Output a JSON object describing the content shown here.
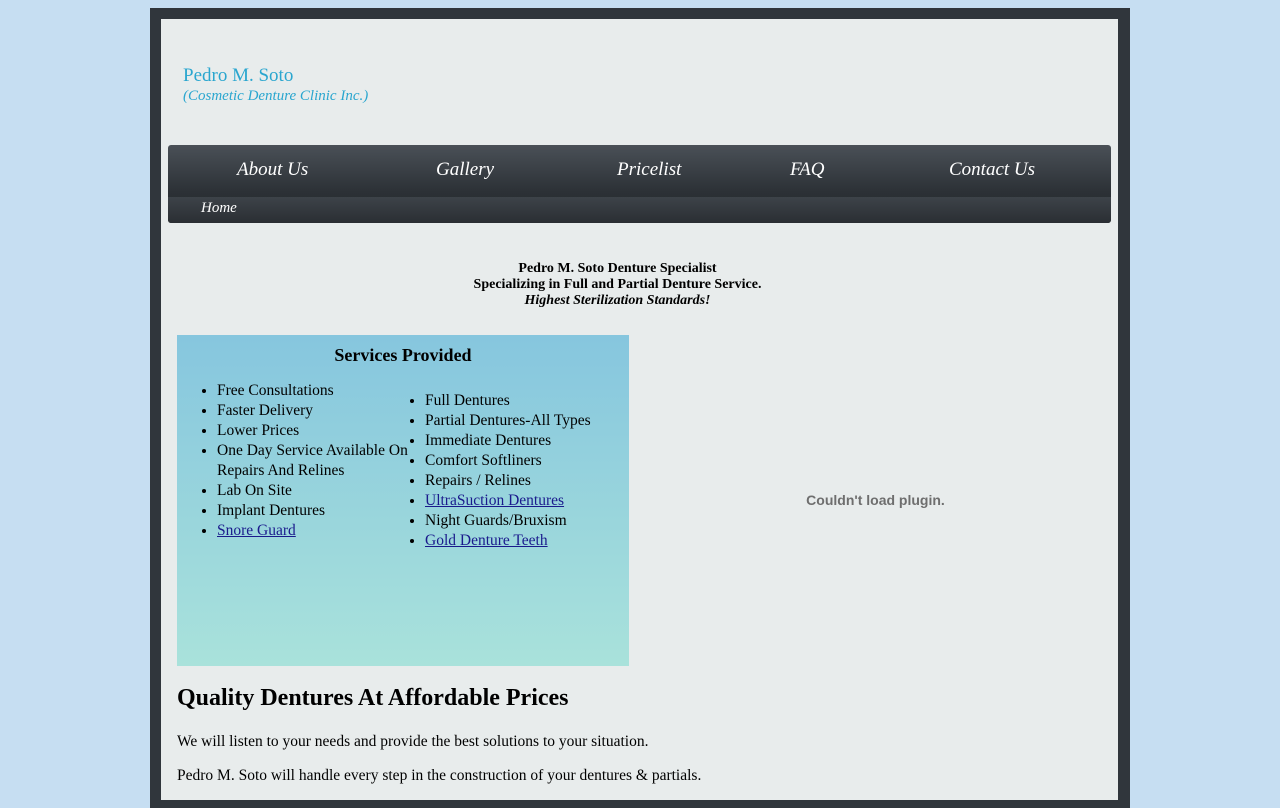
{
  "header": {
    "name": "Pedro M. Soto",
    "tagline": "(Cosmetic Denture Clinic Inc.)"
  },
  "nav": {
    "items": [
      {
        "label": "About Us"
      },
      {
        "label": "Gallery"
      },
      {
        "label": "Pricelist"
      },
      {
        "label": "FAQ"
      },
      {
        "label": "Contact Us"
      }
    ],
    "sub_items": [
      {
        "label": "Home"
      }
    ]
  },
  "intro": {
    "line1": "Pedro M. Soto Denture Specialist",
    "line2": "Specializing in Full and Partial Denture Service.",
    "line3": "Highest Sterilization Standards!"
  },
  "services": {
    "title": "Services Provided",
    "left": [
      {
        "label": "Free Consultations"
      },
      {
        "label": "Faster Delivery"
      },
      {
        "label": "Lower Prices"
      },
      {
        "label": "One Day Service Available On Repairs And Relines"
      },
      {
        "label": "Lab On Site"
      },
      {
        "label": "Implant Dentures"
      },
      {
        "label": "Snore Guard",
        "link": true
      }
    ],
    "right": [
      {
        "label": "Full Dentures"
      },
      {
        "label": "Partial Dentures-All Types"
      },
      {
        "label": "Immediate Dentures"
      },
      {
        "label": "Comfort Softliners"
      },
      {
        "label": "Repairs / Relines"
      },
      {
        "label": "UltraSuction Dentures",
        "link": true
      },
      {
        "label": "Night Guards/Bruxism"
      },
      {
        "label": "Gold Denture Teeth",
        "link": true
      }
    ]
  },
  "plugin": {
    "message": "Couldn't load plugin."
  },
  "content": {
    "heading": "Quality Dentures At Affordable Prices",
    "paragraphs": [
      "We will listen to your needs and provide the best solutions to your situation.",
      "Pedro M. Soto will handle every step in the construction of your dentures & partials."
    ]
  },
  "colors": {
    "page_bg": "#c6def2",
    "frame": "#30363c",
    "panel": "#e8ecec",
    "brand": "#2aa6cf",
    "link": "#1a1a8c"
  }
}
